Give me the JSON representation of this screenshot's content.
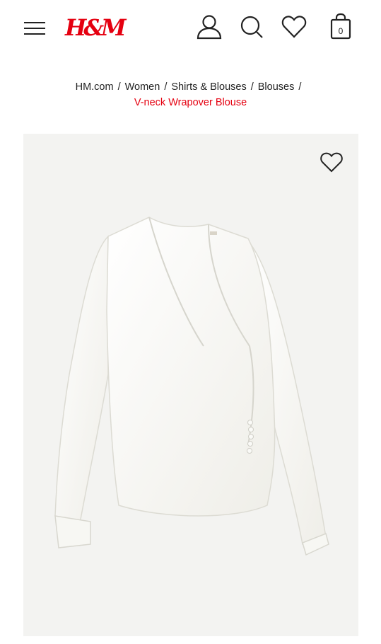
{
  "header": {
    "menu_icon": "hamburger-menu-icon",
    "logo_text": "H&M",
    "account_icon": "person-icon",
    "search_icon": "search-icon",
    "favorites_icon": "heart-icon",
    "bag_icon": "shopping-bag-icon",
    "bag_count": "0"
  },
  "breadcrumb": {
    "items": [
      "HM.com",
      "Women",
      "Shirts & Blouses",
      "Blouses"
    ],
    "separator": "/",
    "current": "V-neck Wrapover Blouse"
  },
  "product": {
    "wishlist_icon": "heart-outline-icon",
    "image_icon": "blouse-product-image"
  },
  "colors": {
    "brand_red": "#e50010",
    "text": "#222222",
    "image_bg": "#f3f3f1"
  }
}
